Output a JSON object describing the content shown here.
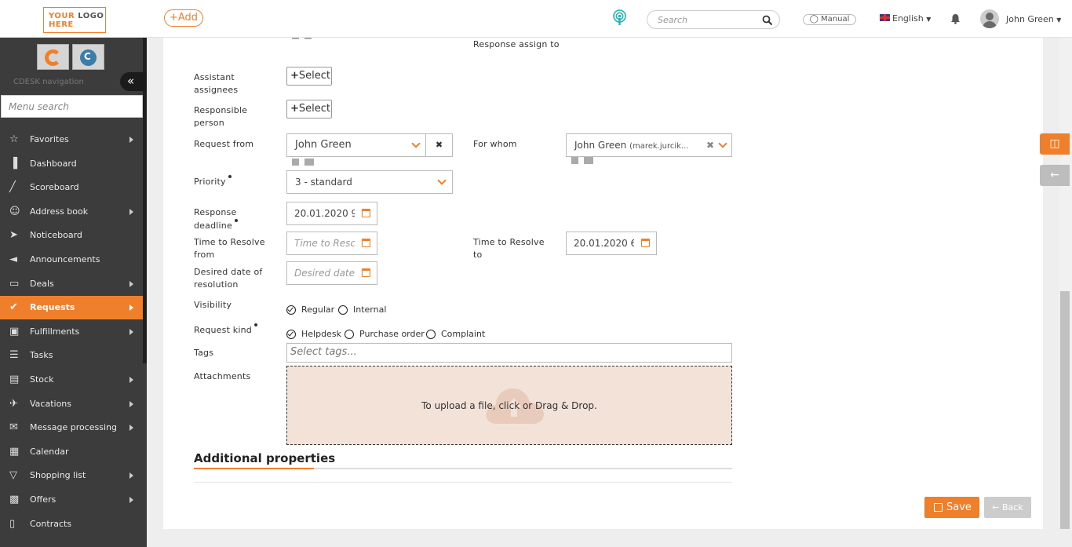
{
  "header": {
    "logo_line1_a": "YOUR",
    "logo_line1_b": "LOGO",
    "logo_line2": "HERE",
    "add_label": "+Add",
    "search_placeholder": "Search",
    "manual_label": "Manual",
    "language": "English",
    "user_name": "John Green"
  },
  "sidebar": {
    "nav_label": "CDESK navigation",
    "menu_search_placeholder": "Menu search",
    "items": [
      {
        "label": "Favorites",
        "icon": "star-icon",
        "arrow": true
      },
      {
        "label": "Dashboard",
        "icon": "bar-chart-icon",
        "arrow": false
      },
      {
        "label": "Scoreboard",
        "icon": "line-chart-icon",
        "arrow": false
      },
      {
        "label": "Address book",
        "icon": "user-icon",
        "arrow": true
      },
      {
        "label": "Noticeboard",
        "icon": "paper-plane-icon",
        "arrow": false
      },
      {
        "label": "Announcements",
        "icon": "bullhorn-icon",
        "arrow": false
      },
      {
        "label": "Deals",
        "icon": "credit-card-icon",
        "arrow": true
      },
      {
        "label": "Requests",
        "icon": "check-circle-icon",
        "arrow": true,
        "active": true
      },
      {
        "label": "Fulfillments",
        "icon": "cube-icon",
        "arrow": true
      },
      {
        "label": "Tasks",
        "icon": "tasks-icon",
        "arrow": false
      },
      {
        "label": "Stock",
        "icon": "archive-icon",
        "arrow": true
      },
      {
        "label": "Vacations",
        "icon": "plane-icon",
        "arrow": true
      },
      {
        "label": "Message processing",
        "icon": "envelope-icon",
        "arrow": true
      },
      {
        "label": "Calendar",
        "icon": "calendar-icon",
        "arrow": false
      },
      {
        "label": "Shopping list",
        "icon": "cart-icon",
        "arrow": true
      },
      {
        "label": "Offers",
        "icon": "gift-icon",
        "arrow": true
      },
      {
        "label": "Contracts",
        "icon": "file-icon",
        "arrow": false
      }
    ]
  },
  "form": {
    "response_assign_to": "Response assign to",
    "assistant_assignees": "Assistant assignees",
    "responsible_person": "Responsible person",
    "select_label": "Select",
    "request_from_label": "Request from",
    "request_from_value": "John Green",
    "for_whom_label": "For whom",
    "for_whom_value": "John Green",
    "for_whom_extra": "(marek.jurcik...",
    "priority_label": "Priority",
    "priority_value": "3 - standard",
    "response_deadline_label": "Response deadline",
    "response_deadline_value": "20.01.2020 9",
    "ttr_from_label": "Time to Resolve from",
    "ttr_from_placeholder": "Time to Resc",
    "ttr_to_label": "Time to Resolve to",
    "ttr_to_value": "20.01.2020 6",
    "desired_label": "Desired date of resolution",
    "desired_placeholder": "Desired date",
    "visibility_label": "Visibility",
    "visibility_options": [
      "Regular",
      "Internal"
    ],
    "visibility_selected": "Regular",
    "request_kind_label": "Request kind",
    "request_kind_options": [
      "Helpdesk",
      "Purchase order",
      "Complaint"
    ],
    "request_kind_selected": "Helpdesk",
    "tags_label": "Tags",
    "tags_placeholder": "Select tags...",
    "attachments_label": "Attachments",
    "upload_text": "To upload a file, click or Drag & Drop.",
    "additional_properties": "Additional properties",
    "save_label": "Save",
    "back_label": "Back"
  },
  "colors": {
    "accent": "#f07f2b",
    "sidebar_bg": "#3c3c3c",
    "upload_bg": "#f2e2d8"
  }
}
